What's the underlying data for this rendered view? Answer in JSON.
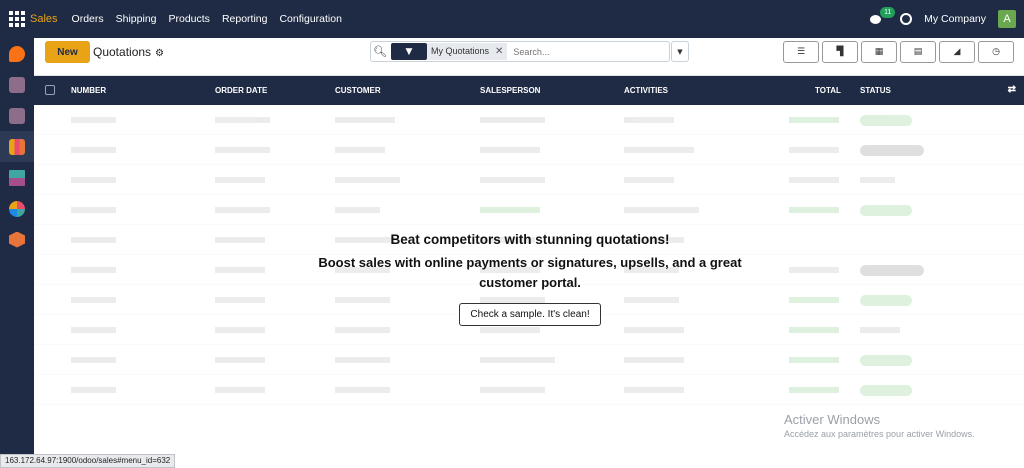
{
  "navbar": {
    "brand": "Sales",
    "menu": [
      "Orders",
      "Shipping",
      "Products",
      "Reporting",
      "Configuration"
    ],
    "chat_count": "11",
    "company": "My Company",
    "avatar_letter": "A"
  },
  "sidebar": {
    "apps": [
      {
        "icon": "discuss-icon",
        "color": "#f97316"
      },
      {
        "icon": "inventory-icon",
        "color": "#8e6d8a"
      },
      {
        "icon": "inventory-icon",
        "color": "#8e6d8a"
      },
      {
        "icon": "sales-icon",
        "color": "#e8a317"
      },
      {
        "icon": "purchase-icon",
        "color": "#3fa7a0"
      },
      {
        "icon": "dashboard-icon",
        "color": "#e94b6a"
      },
      {
        "icon": "odoo-icon",
        "color": "#e8743b"
      }
    ]
  },
  "control": {
    "new_label": "New",
    "title": "Quotations",
    "facet_label": "My Quotations",
    "search_placeholder": "Search..."
  },
  "table": {
    "columns": [
      "NUMBER",
      "ORDER DATE",
      "CUSTOMER",
      "SALESPERSON",
      "ACTIVITIES",
      "TOTAL",
      "STATUS"
    ]
  },
  "helper": {
    "title": "Beat competitors with stunning quotations!",
    "body": "Boost sales with online payments or signatures, upsells, and a great customer portal.",
    "button": "Check a sample. It's clean!"
  },
  "watermark": {
    "title": "Activer Windows",
    "subtitle": "Accédez aux paramètres pour activer Windows."
  },
  "status_url": "163.172.64.97:1900/odoo/sales#menu_id=632"
}
